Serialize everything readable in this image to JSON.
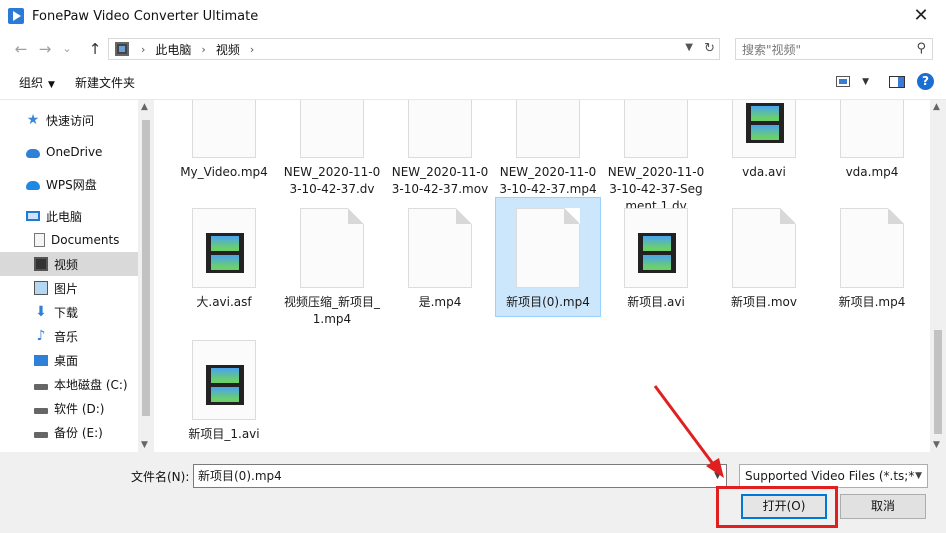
{
  "window": {
    "title": "FonePaw Video Converter Ultimate",
    "close_glyph": "✕"
  },
  "nav": {
    "back_glyph": "←",
    "forward_glyph": "→",
    "recent_glyph": "⌄",
    "up_glyph": "↑",
    "breadcrumb": [
      "此电脑",
      "视频"
    ],
    "crumb_sep": "›",
    "search_placeholder": "搜索\"视频\""
  },
  "toolbar": {
    "organize_label": "组织",
    "new_folder_label": "新建文件夹"
  },
  "sidebar": {
    "items": [
      {
        "label": "快速访问",
        "icon": "star-icon"
      },
      {
        "label": "OneDrive",
        "icon": "cloud-icon"
      },
      {
        "label": "WPS网盘",
        "icon": "wps-cloud-icon"
      },
      {
        "label": "此电脑",
        "icon": "computer-icon"
      },
      {
        "label": "Documents",
        "icon": "document-icon"
      },
      {
        "label": "视频",
        "icon": "video-folder-icon",
        "selected": true
      },
      {
        "label": "图片",
        "icon": "picture-folder-icon"
      },
      {
        "label": "下载",
        "icon": "download-icon"
      },
      {
        "label": "音乐",
        "icon": "music-icon"
      },
      {
        "label": "桌面",
        "icon": "desktop-icon"
      },
      {
        "label": "本地磁盘 (C:)",
        "icon": "drive-icon"
      },
      {
        "label": "软件 (D:)",
        "icon": "drive-icon"
      },
      {
        "label": "备份 (E:)",
        "icon": "drive-icon"
      }
    ]
  },
  "files": [
    {
      "name": "My_Video.mp4",
      "type": "doc"
    },
    {
      "name": "NEW_2020-11-03-10-42-37.dv",
      "type": "doc"
    },
    {
      "name": "NEW_2020-11-03-10-42-37.mov",
      "type": "doc"
    },
    {
      "name": "NEW_2020-11-03-10-42-37.mp4",
      "type": "doc"
    },
    {
      "name": "NEW_2020-11-03-10-42-37-Segment 1.dv",
      "type": "doc"
    },
    {
      "name": "vda.avi",
      "type": "video"
    },
    {
      "name": "vda.mp4",
      "type": "doc"
    },
    {
      "name": "大.avi.asf",
      "type": "video"
    },
    {
      "name": "视频压缩_新项目_1.mp4",
      "type": "doc"
    },
    {
      "name": "是.mp4",
      "type": "doc"
    },
    {
      "name": "新项目(0).mp4",
      "type": "doc",
      "selected": true
    },
    {
      "name": "新项目.avi",
      "type": "video"
    },
    {
      "name": "新项目.mov",
      "type": "doc"
    },
    {
      "name": "新项目.mp4",
      "type": "doc"
    },
    {
      "name": "新项目_1.avi",
      "type": "video"
    }
  ],
  "footer": {
    "filename_label": "文件名(N):",
    "filename_value": "新项目(0).mp4",
    "filetype_value": "Supported Video Files (*.ts;*",
    "open_label": "打开(O)",
    "cancel_label": "取消"
  },
  "colors": {
    "accent": "#0078d7",
    "selection": "#cce6fb",
    "annotation": "#e02020"
  }
}
